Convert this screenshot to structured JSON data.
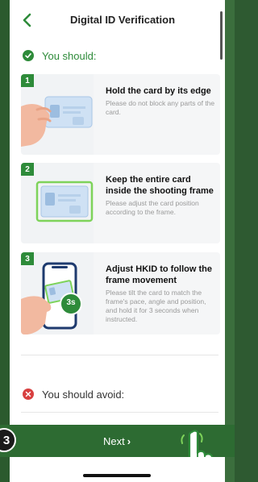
{
  "header": {
    "title": "Digital ID Verification",
    "back_icon": "chevron-left-icon"
  },
  "should": {
    "label": "You should:",
    "icon": "check-circle-icon"
  },
  "steps": [
    {
      "number": "1",
      "title": "Hold the card by its edge",
      "desc": "Please do not block any parts of the card."
    },
    {
      "number": "2",
      "title": "Keep the entire card inside the shooting frame",
      "desc": "Please adjust the card position according to the frame."
    },
    {
      "number": "3",
      "title": "Adjust HKID to follow the frame movement",
      "desc": "Please tilt the card to match the frame's pace, angle and position, and hold it for 3 seconds when instructed.",
      "timer": "3s"
    }
  ],
  "avoid": {
    "label": "You should avoid:",
    "icon": "x-circle-icon"
  },
  "footer": {
    "next_label": "Next",
    "next_icon": "chevron-right-icon",
    "step_marker": "3"
  },
  "colors": {
    "brand_green": "#2e8b3a",
    "bar_green": "#2d6b32",
    "error_red": "#d84040"
  }
}
